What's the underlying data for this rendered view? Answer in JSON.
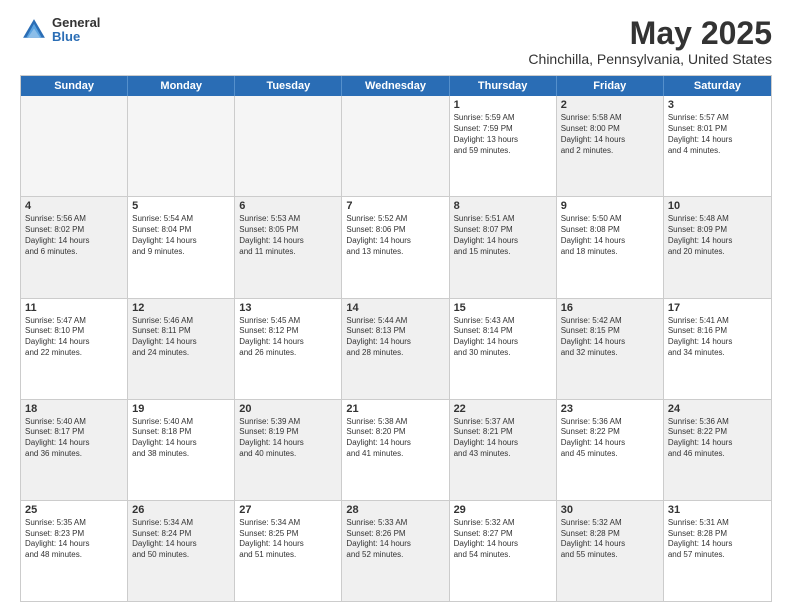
{
  "logo": {
    "general": "General",
    "blue": "Blue"
  },
  "title": "May 2025",
  "subtitle": "Chinchilla, Pennsylvania, United States",
  "calendar": {
    "headers": [
      "Sunday",
      "Monday",
      "Tuesday",
      "Wednesday",
      "Thursday",
      "Friday",
      "Saturday"
    ],
    "rows": [
      [
        {
          "day": "",
          "empty": true,
          "lines": []
        },
        {
          "day": "",
          "empty": true,
          "lines": []
        },
        {
          "day": "",
          "empty": true,
          "lines": []
        },
        {
          "day": "",
          "empty": true,
          "lines": []
        },
        {
          "day": "1",
          "lines": [
            "Sunrise: 5:59 AM",
            "Sunset: 7:59 PM",
            "Daylight: 13 hours",
            "and 59 minutes."
          ]
        },
        {
          "day": "2",
          "shaded": true,
          "lines": [
            "Sunrise: 5:58 AM",
            "Sunset: 8:00 PM",
            "Daylight: 14 hours",
            "and 2 minutes."
          ]
        },
        {
          "day": "3",
          "lines": [
            "Sunrise: 5:57 AM",
            "Sunset: 8:01 PM",
            "Daylight: 14 hours",
            "and 4 minutes."
          ]
        }
      ],
      [
        {
          "day": "4",
          "shaded": true,
          "lines": [
            "Sunrise: 5:56 AM",
            "Sunset: 8:02 PM",
            "Daylight: 14 hours",
            "and 6 minutes."
          ]
        },
        {
          "day": "5",
          "lines": [
            "Sunrise: 5:54 AM",
            "Sunset: 8:04 PM",
            "Daylight: 14 hours",
            "and 9 minutes."
          ]
        },
        {
          "day": "6",
          "shaded": true,
          "lines": [
            "Sunrise: 5:53 AM",
            "Sunset: 8:05 PM",
            "Daylight: 14 hours",
            "and 11 minutes."
          ]
        },
        {
          "day": "7",
          "lines": [
            "Sunrise: 5:52 AM",
            "Sunset: 8:06 PM",
            "Daylight: 14 hours",
            "and 13 minutes."
          ]
        },
        {
          "day": "8",
          "shaded": true,
          "lines": [
            "Sunrise: 5:51 AM",
            "Sunset: 8:07 PM",
            "Daylight: 14 hours",
            "and 15 minutes."
          ]
        },
        {
          "day": "9",
          "lines": [
            "Sunrise: 5:50 AM",
            "Sunset: 8:08 PM",
            "Daylight: 14 hours",
            "and 18 minutes."
          ]
        },
        {
          "day": "10",
          "shaded": true,
          "lines": [
            "Sunrise: 5:48 AM",
            "Sunset: 8:09 PM",
            "Daylight: 14 hours",
            "and 20 minutes."
          ]
        }
      ],
      [
        {
          "day": "11",
          "lines": [
            "Sunrise: 5:47 AM",
            "Sunset: 8:10 PM",
            "Daylight: 14 hours",
            "and 22 minutes."
          ]
        },
        {
          "day": "12",
          "shaded": true,
          "lines": [
            "Sunrise: 5:46 AM",
            "Sunset: 8:11 PM",
            "Daylight: 14 hours",
            "and 24 minutes."
          ]
        },
        {
          "day": "13",
          "lines": [
            "Sunrise: 5:45 AM",
            "Sunset: 8:12 PM",
            "Daylight: 14 hours",
            "and 26 minutes."
          ]
        },
        {
          "day": "14",
          "shaded": true,
          "lines": [
            "Sunrise: 5:44 AM",
            "Sunset: 8:13 PM",
            "Daylight: 14 hours",
            "and 28 minutes."
          ]
        },
        {
          "day": "15",
          "lines": [
            "Sunrise: 5:43 AM",
            "Sunset: 8:14 PM",
            "Daylight: 14 hours",
            "and 30 minutes."
          ]
        },
        {
          "day": "16",
          "shaded": true,
          "lines": [
            "Sunrise: 5:42 AM",
            "Sunset: 8:15 PM",
            "Daylight: 14 hours",
            "and 32 minutes."
          ]
        },
        {
          "day": "17",
          "lines": [
            "Sunrise: 5:41 AM",
            "Sunset: 8:16 PM",
            "Daylight: 14 hours",
            "and 34 minutes."
          ]
        }
      ],
      [
        {
          "day": "18",
          "shaded": true,
          "lines": [
            "Sunrise: 5:40 AM",
            "Sunset: 8:17 PM",
            "Daylight: 14 hours",
            "and 36 minutes."
          ]
        },
        {
          "day": "19",
          "lines": [
            "Sunrise: 5:40 AM",
            "Sunset: 8:18 PM",
            "Daylight: 14 hours",
            "and 38 minutes."
          ]
        },
        {
          "day": "20",
          "shaded": true,
          "lines": [
            "Sunrise: 5:39 AM",
            "Sunset: 8:19 PM",
            "Daylight: 14 hours",
            "and 40 minutes."
          ]
        },
        {
          "day": "21",
          "lines": [
            "Sunrise: 5:38 AM",
            "Sunset: 8:20 PM",
            "Daylight: 14 hours",
            "and 41 minutes."
          ]
        },
        {
          "day": "22",
          "shaded": true,
          "lines": [
            "Sunrise: 5:37 AM",
            "Sunset: 8:21 PM",
            "Daylight: 14 hours",
            "and 43 minutes."
          ]
        },
        {
          "day": "23",
          "lines": [
            "Sunrise: 5:36 AM",
            "Sunset: 8:22 PM",
            "Daylight: 14 hours",
            "and 45 minutes."
          ]
        },
        {
          "day": "24",
          "shaded": true,
          "lines": [
            "Sunrise: 5:36 AM",
            "Sunset: 8:22 PM",
            "Daylight: 14 hours",
            "and 46 minutes."
          ]
        }
      ],
      [
        {
          "day": "25",
          "lines": [
            "Sunrise: 5:35 AM",
            "Sunset: 8:23 PM",
            "Daylight: 14 hours",
            "and 48 minutes."
          ]
        },
        {
          "day": "26",
          "shaded": true,
          "lines": [
            "Sunrise: 5:34 AM",
            "Sunset: 8:24 PM",
            "Daylight: 14 hours",
            "and 50 minutes."
          ]
        },
        {
          "day": "27",
          "lines": [
            "Sunrise: 5:34 AM",
            "Sunset: 8:25 PM",
            "Daylight: 14 hours",
            "and 51 minutes."
          ]
        },
        {
          "day": "28",
          "shaded": true,
          "lines": [
            "Sunrise: 5:33 AM",
            "Sunset: 8:26 PM",
            "Daylight: 14 hours",
            "and 52 minutes."
          ]
        },
        {
          "day": "29",
          "lines": [
            "Sunrise: 5:32 AM",
            "Sunset: 8:27 PM",
            "Daylight: 14 hours",
            "and 54 minutes."
          ]
        },
        {
          "day": "30",
          "shaded": true,
          "lines": [
            "Sunrise: 5:32 AM",
            "Sunset: 8:28 PM",
            "Daylight: 14 hours",
            "and 55 minutes."
          ]
        },
        {
          "day": "31",
          "lines": [
            "Sunrise: 5:31 AM",
            "Sunset: 8:28 PM",
            "Daylight: 14 hours",
            "and 57 minutes."
          ]
        }
      ]
    ]
  }
}
